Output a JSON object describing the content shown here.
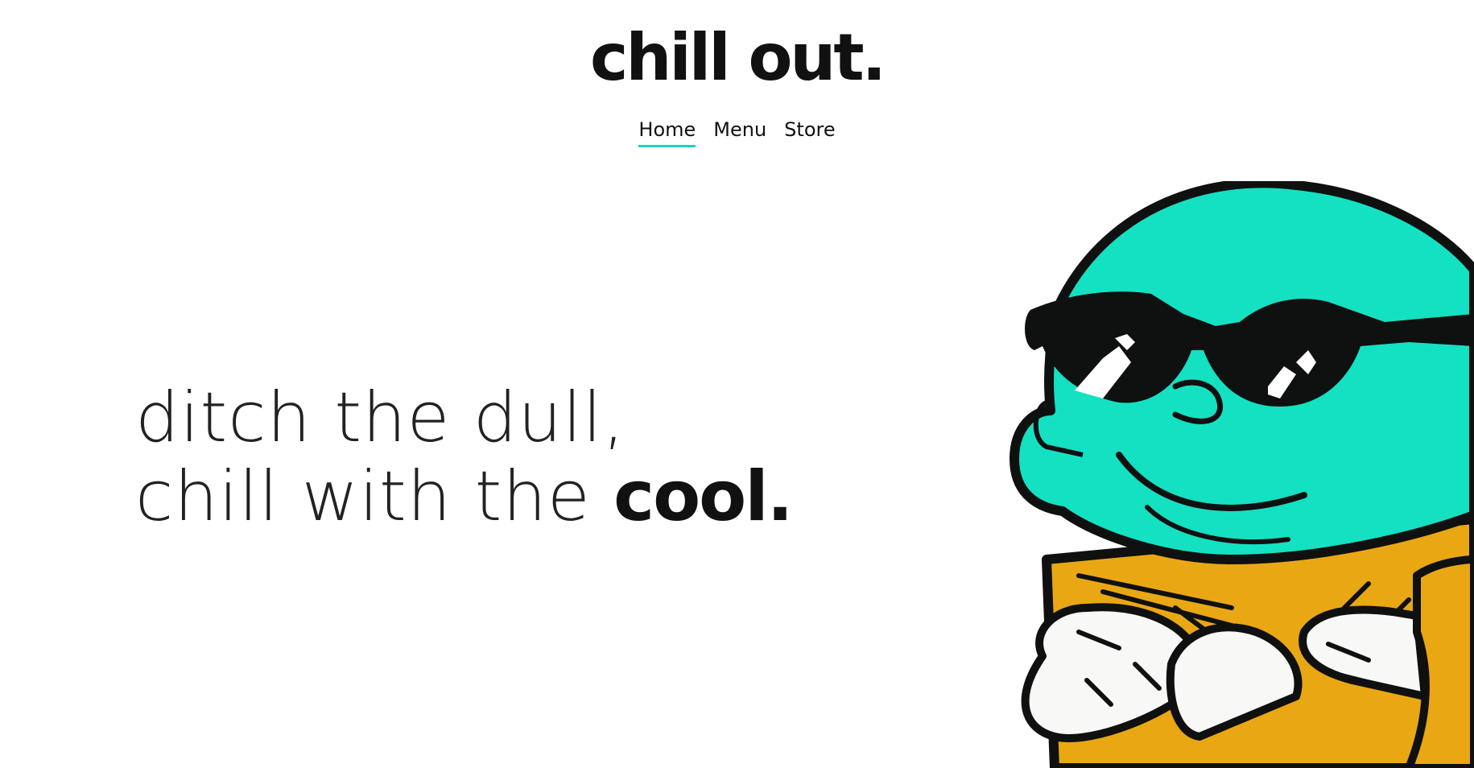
{
  "header": {
    "brand": "chill out.",
    "nav": [
      {
        "label": "Home",
        "active": true
      },
      {
        "label": "Menu",
        "active": false
      },
      {
        "label": "Store",
        "active": false
      }
    ]
  },
  "hero": {
    "line1": "ditch the dull,",
    "line2_prefix": "chill with the",
    "line2_bold": "cool."
  },
  "mascot": {
    "name": "ice-cream-mascot-with-sunglasses"
  },
  "colors": {
    "accent": "#14d6bd",
    "scoop": "#14e0c2",
    "cone": "#e9a714",
    "outline": "#0f1010",
    "hands": "#f8f8f6"
  }
}
